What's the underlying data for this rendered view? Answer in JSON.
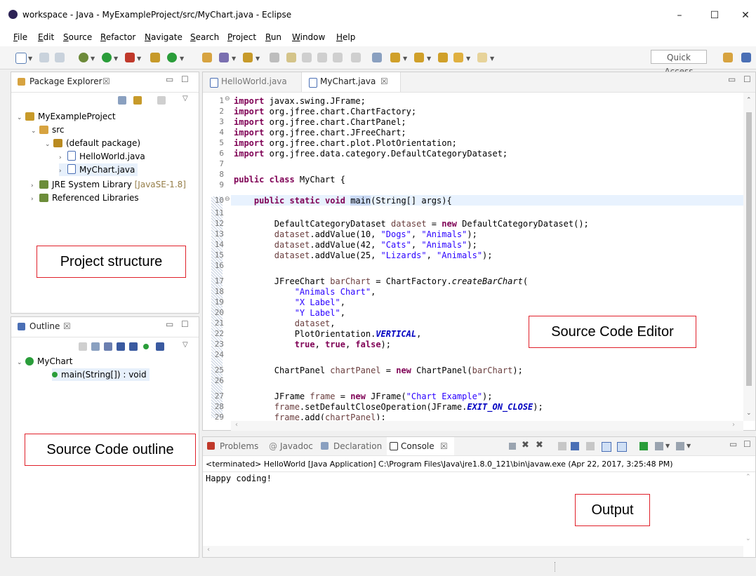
{
  "window": {
    "title": "workspace - Java - MyExampleProject/src/MyChart.java - Eclipse",
    "minimize": "–",
    "maximize": "☐",
    "close": "✕"
  },
  "menu": [
    "File",
    "Edit",
    "Source",
    "Refactor",
    "Navigate",
    "Search",
    "Project",
    "Run",
    "Window",
    "Help"
  ],
  "toolbar": {
    "quick_access": "Quick Access"
  },
  "package_explorer": {
    "title": "Package Explorer",
    "close": "☒",
    "tree": [
      {
        "label": "MyExampleProject",
        "indent": 0,
        "arrow": "⌄",
        "icon": "project-icon",
        "color": "#c79a2a"
      },
      {
        "label": "src",
        "indent": 1,
        "arrow": "⌄",
        "icon": "source-folder-icon",
        "color": "#d7a340"
      },
      {
        "label": "(default package)",
        "indent": 2,
        "arrow": "⌄",
        "icon": "package-icon",
        "color": "#b98a20"
      },
      {
        "label": "HelloWorld.java",
        "indent": 3,
        "arrow": "›",
        "icon": "java-file-icon",
        "color": "#4a6fb5"
      },
      {
        "label": "MyChart.java",
        "indent": 3,
        "arrow": "›",
        "icon": "java-file-icon",
        "color": "#4a6fb5",
        "selected": true
      },
      {
        "label": "JRE System Library",
        "suffix": "[JavaSE-1.8]",
        "indent": 1,
        "arrow": "›",
        "icon": "library-icon",
        "color": "#6c8d3a"
      },
      {
        "label": "Referenced Libraries",
        "indent": 1,
        "arrow": "›",
        "icon": "library-icon",
        "color": "#6c8d3a"
      }
    ]
  },
  "outline": {
    "title": "Outline",
    "close": "☒",
    "class_name": "MyChart",
    "method": "main(String[]) : void"
  },
  "editor": {
    "tabs": [
      {
        "label": "HelloWorld.java",
        "active": false
      },
      {
        "label": "MyChart.java",
        "active": true,
        "close": "☒"
      }
    ],
    "lines": [
      "1",
      "2",
      "3",
      "4",
      "5",
      "6",
      "7",
      "8",
      "9",
      "10",
      "11",
      "12",
      "13",
      "14",
      "15",
      "16",
      "17",
      "18",
      "19",
      "20",
      "21",
      "22",
      "23",
      "24",
      "25",
      "26",
      "27",
      "28",
      "29"
    ]
  },
  "console": {
    "tabs": [
      "Problems",
      "Javadoc",
      "Declaration",
      "Console"
    ],
    "active_tab": "Console",
    "close": "☒",
    "terminated": "<terminated> HelloWorld [Java Application] C:\\Program Files\\Java\\jre1.8.0_121\\bin\\javaw.exe (Apr 22, 2017, 3:25:48 PM)",
    "output": "Happy coding!"
  },
  "callouts": {
    "project": "Project structure",
    "editor": "Source Code Editor",
    "outline": "Source Code outline",
    "output": "Output"
  },
  "colors": {
    "keyword": "#7f0055",
    "string": "#2a00ff",
    "callout_border": "#e0202a"
  }
}
